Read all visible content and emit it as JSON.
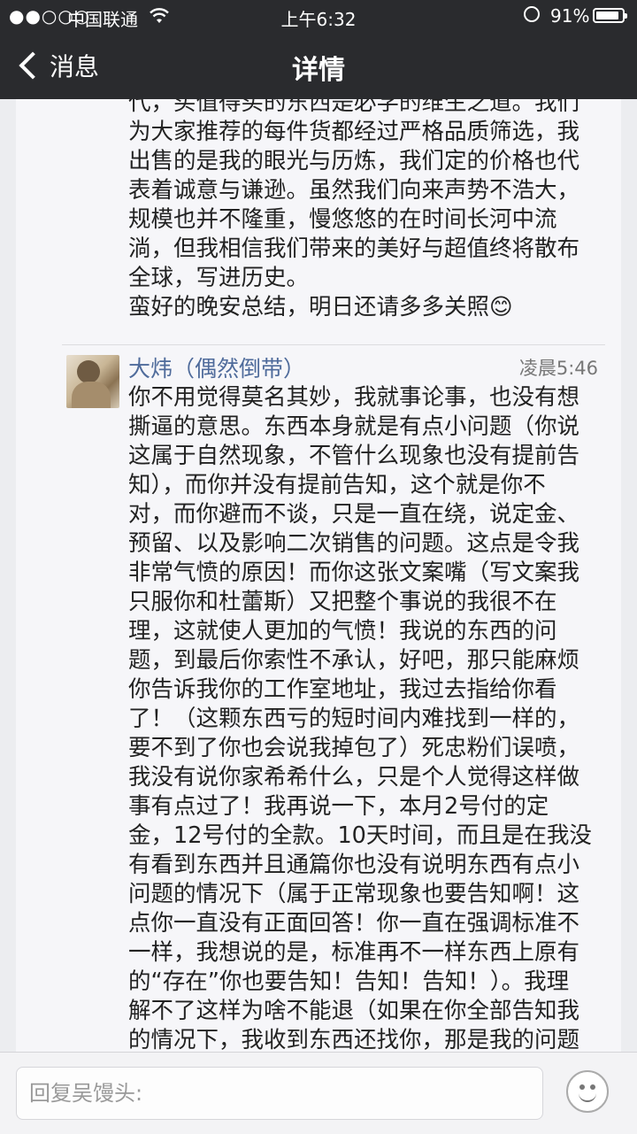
{
  "status_bar": {
    "signal": "●●○○○",
    "carrier": "中国联通",
    "time": "上午6:32",
    "battery_pct": "91%",
    "battery_level": 0.91
  },
  "nav": {
    "back_label": "消息",
    "title": "详情"
  },
  "thread": {
    "previous_message": {
      "text": "代，买值得买的东西是必学的维生之道。我们\n为大家推荐的每件货都经过严格品质筛选，我\n出售的是我的眼光与历炼，我们定的价格也代\n表着诚意与谦逊。虽然我们向来声势不浩大，\n规模也并不隆重，慢悠悠的在时间长河中流\n淌，但我相信我们带来的美好与超值终将散布\n全球，写进历史。\n蛮好的晚安总结，明日还请多多关照😊"
    },
    "comment": {
      "author": "大炜（偶然倒带）",
      "time": "凌晨5:46",
      "text": "你不用觉得莫名其妙，我就事论事，也没有想\n撕逼的意思。东西本身就是有点小问题（你说\n这属于自然现象，不管什么现象也没有提前告\n知），而你并没有提前告知，这个就是你不\n对，而你避而不谈，只是一直在绕，说定金、\n预留、以及影响二次销售的问题。这点是令我\n非常气愤的原因！而你这张文案嘴（写文案我\n只服你和杜蕾斯）又把整个事说的我很不在\n理，这就使人更加的气愤！我说的东西的问\n题，到最后你索性不承认，好吧，那只能麻烦\n你告诉我你的工作室地址，我过去指给你看\n了！（这颗东西亏的短时间内难找到一样的，\n要不到了你也会说我掉包了）死忠粉们误喷，\n我没有说你家希希什么，只是个人觉得这样做\n事有点过了！我再说一下，本月2号付的定\n金，12号付的全款。10天时间，而且是在我没\n有看到东西并且通篇你也没有说明东西有点小\n问题的情况下（属于正常现象也要告知啊！这\n点你一直没有正面回答！你一直在强调标准不\n一样，我想说的是，标准再不一样东西上原有\n的“存在”你也要告知！告知！告知！）。我理\n解不了这样为啥不能退（如果在你全部告知我\n的情况下，我收到东西还找你，那是我的问题\n）你帮我解决的方案就是代卖，我不接受！"
    }
  },
  "reply": {
    "placeholder": "回复吴馒头:"
  },
  "colors": {
    "bar_bg": "#2a2b2e",
    "author_name": "#4f6b9b",
    "content_bg": "#f6f6f9"
  }
}
